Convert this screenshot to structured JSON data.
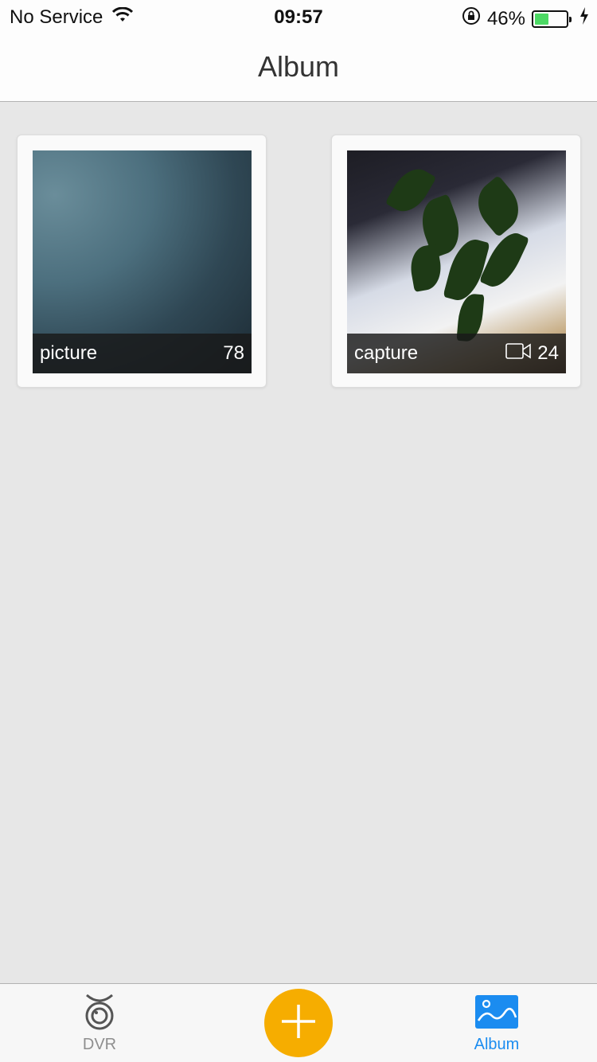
{
  "status_bar": {
    "carrier": "No Service",
    "time": "09:57",
    "battery_percent": "46%",
    "battery_level": 0.46,
    "icons": [
      "wifi-icon",
      "rotation-lock-icon",
      "battery-icon",
      "charging-icon"
    ]
  },
  "nav": {
    "title": "Album"
  },
  "albums": [
    {
      "name": "picture",
      "count": "78",
      "has_video_icon": false
    },
    {
      "name": "capture",
      "count": "24",
      "has_video_icon": true
    }
  ],
  "tab_bar": {
    "dvr_label": "DVR",
    "album_label": "Album",
    "add_icon": "plus-icon"
  },
  "colors": {
    "accent_blue": "#1b8cf0",
    "add_button": "#f6ad00",
    "battery_green": "#4cd964",
    "background": "#e7e7e7"
  }
}
